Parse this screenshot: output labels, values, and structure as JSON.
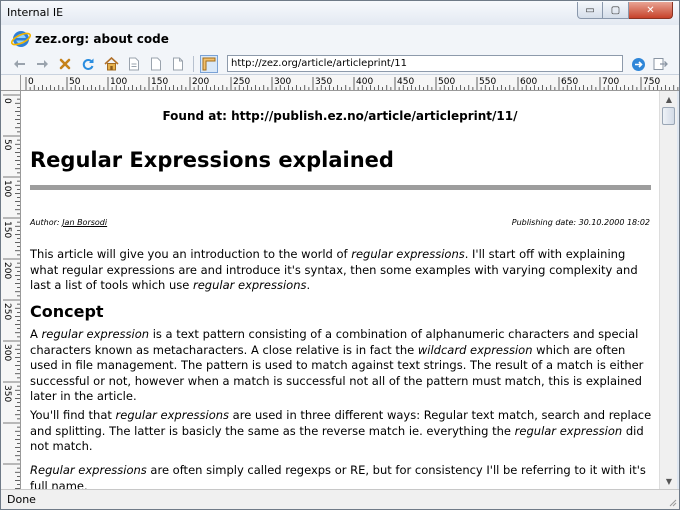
{
  "window": {
    "title": "Internal IE",
    "minimize": "▭",
    "maximize": "▢",
    "close": "✕"
  },
  "page": {
    "title": "zez.org: about code"
  },
  "toolbar": {
    "icons": [
      "back-arrow-icon",
      "forward-arrow-icon",
      "stop-icon",
      "refresh-icon",
      "home-icon",
      "page-icon",
      "page-icon",
      "page-icon",
      "ruler-toggle-icon",
      "go-icon",
      "exit-icon"
    ],
    "address": "http://zez.org/article/articleprint/11"
  },
  "ruler": {
    "h_labels": [
      "0",
      "50",
      "100",
      "150",
      "200",
      "250",
      "300",
      "350",
      "400",
      "450",
      "500",
      "550",
      "600",
      "650",
      "700",
      "750"
    ],
    "v_labels": [
      "0",
      "50",
      "100",
      "150",
      "200",
      "250",
      "300",
      "350"
    ]
  },
  "article": {
    "found_at": "Found at: http://publish.ez.no/article/articleprint/11/",
    "heading": "Regular Expressions explained",
    "author_label": "Author:",
    "author_name": "Jan Borsodi",
    "publish_label": "Publishing date: 30.10.2000 18:02",
    "intro_1": "This article will give you an introduction to the world of ",
    "intro_2": "regular expressions",
    "intro_3": ". I'll start off with explaining what regular expressions are and introduce it's syntax, then some examples with varying complexity and last a list of tools which use ",
    "intro_4": "regular expressions",
    "intro_5": ".",
    "concept_heading": "Concept",
    "p1_1": "A ",
    "p1_2": "regular expression",
    "p1_3": " is a text pattern consisting of a combination of alphanumeric characters and special characters known as metacharacters. A close relative is in fact the ",
    "p1_4": "wildcard expression",
    "p1_5": " which are often used in file management. The pattern is used to match against text strings. The result of a match is either successful or not, however when a match is successful not all of the pattern must match, this is explained later in the article.",
    "p2_1": "You'll find that ",
    "p2_2": "regular expressions",
    "p2_3": " are used in three different ways: Regular text match, search and replace and splitting. The latter is basicly the same as the reverse match ie. everything the ",
    "p2_4": "regular expression",
    "p2_5": " did not match.",
    "p3_1": "Regular expressions",
    "p3_2": " are often simply called regexps or RE, but for consistency I'll be referring to it with it's full name."
  },
  "status": {
    "text": "Done"
  }
}
